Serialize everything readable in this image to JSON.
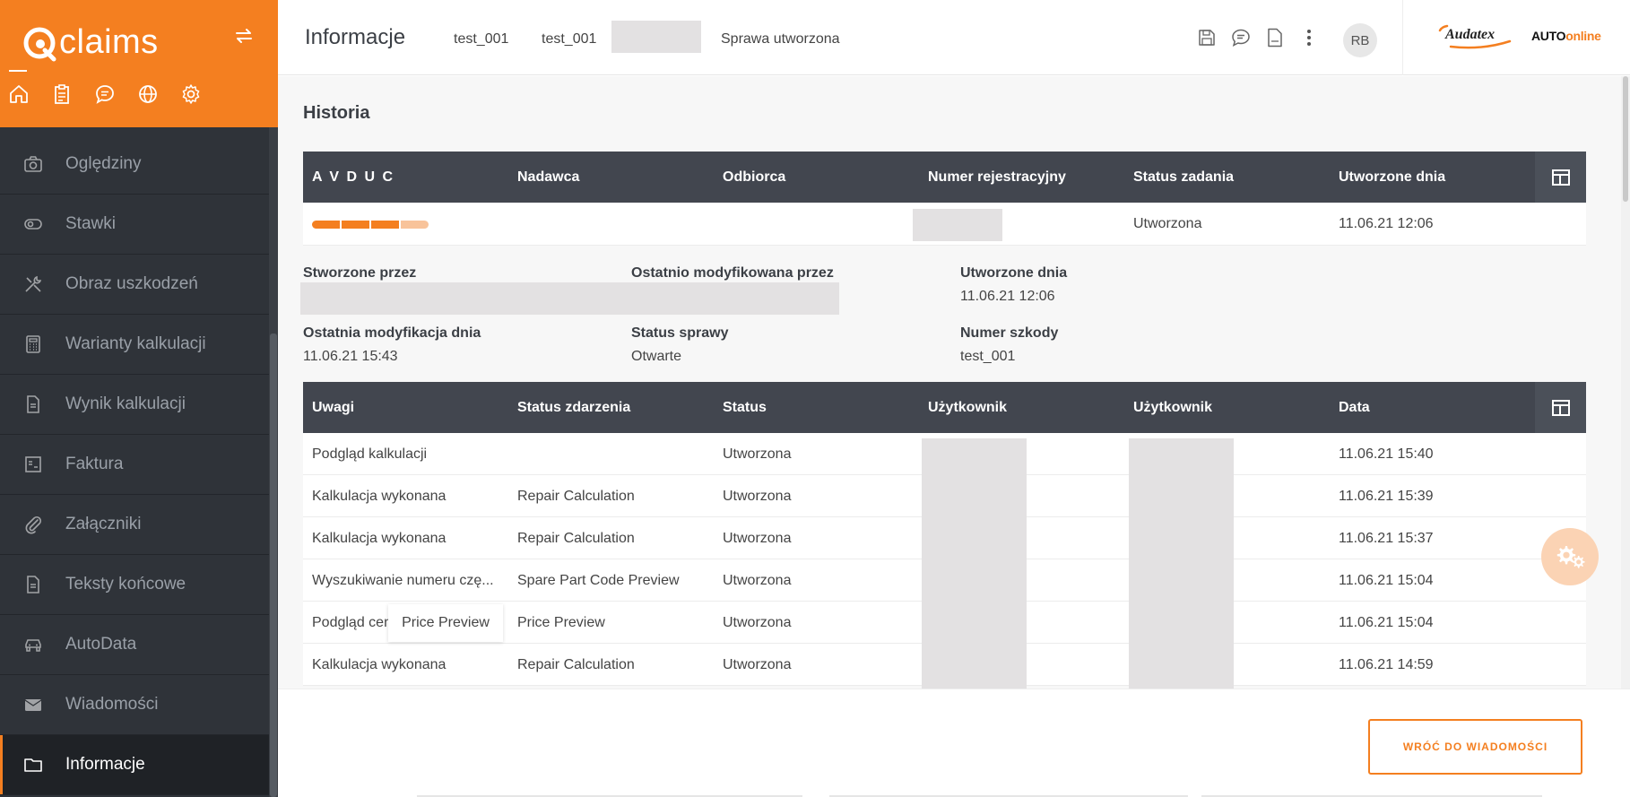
{
  "sidebar": {
    "brand": "claims",
    "items": [
      {
        "label": "Oględziny",
        "icon": "camera-icon"
      },
      {
        "label": "Stawki",
        "icon": "rates-icon"
      },
      {
        "label": "Obraz uszkodzeń",
        "icon": "tools-icon"
      },
      {
        "label": "Warianty kalkulacji",
        "icon": "calculator-icon"
      },
      {
        "label": "Wynik kalkulacji",
        "icon": "document-icon"
      },
      {
        "label": "Faktura",
        "icon": "invoice-icon"
      },
      {
        "label": "Załączniki",
        "icon": "paperclip-icon"
      },
      {
        "label": "Teksty końcowe",
        "icon": "document-icon"
      },
      {
        "label": "AutoData",
        "icon": "car-icon"
      },
      {
        "label": "Wiadomości",
        "icon": "mail-icon"
      },
      {
        "label": "Informacje",
        "icon": "folder-icon",
        "active": true
      }
    ]
  },
  "header": {
    "title": "Informacje",
    "case_id_1": "test_001",
    "case_id_2": "test_001",
    "status": "Sprawa utworzona",
    "avatar": "RB",
    "logo_audatex": "Audatex",
    "logo_auto": "AUTO",
    "logo_online": "online"
  },
  "history": {
    "title": "Historia",
    "columns": [
      "A V D U C",
      "Nadawca",
      "Odbiorca",
      "Numer rejestracyjny",
      "Status zadania",
      "Utworzone dnia"
    ],
    "progress_filled": 3,
    "progress_total": 4,
    "row": {
      "status": "Utworzona",
      "date": "11.06.21 12:06"
    }
  },
  "meta": {
    "created_by_label": "Stworzone przez",
    "modified_by_label": "Ostatnio modyfikowana przez",
    "created_on_label": "Utworzone dnia",
    "created_on_value": "11.06.21 12:06",
    "last_modified_label": "Ostatnia modyfikacja dnia",
    "last_modified_value": "11.06.21 15:43",
    "case_status_label": "Status sprawy",
    "case_status_value": "Otwarte",
    "damage_no_label": "Numer szkody",
    "damage_no_value": "test_001"
  },
  "events": {
    "columns": [
      "Uwagi",
      "Status zdarzenia",
      "Status",
      "Użytkownik",
      "Użytkownik",
      "Data"
    ],
    "rows": [
      {
        "note": "Podgląd kalkulacji",
        "event": "",
        "status": "Utworzona",
        "date": "11.06.21 15:40"
      },
      {
        "note": "Kalkulacja wykonana",
        "event": "Repair Calculation",
        "status": "Utworzona",
        "date": "11.06.21 15:39"
      },
      {
        "note": "Kalkulacja wykonana",
        "event": "Repair Calculation",
        "status": "Utworzona",
        "date": "11.06.21 15:37"
      },
      {
        "note": "Wyszukiwanie numeru czę...",
        "event": "Spare Part Code Preview",
        "status": "Utworzona",
        "date": "11.06.21 15:04"
      },
      {
        "note": "Podgląd cen",
        "event": "Price Preview",
        "status": "Utworzona",
        "date": "11.06.21 15:04"
      },
      {
        "note": "Kalkulacja wykonana",
        "event": "Repair Calculation",
        "status": "Utworzona",
        "date": "11.06.21 14:59"
      }
    ],
    "tooltip": "Price Preview"
  },
  "footer": {
    "back_button": "WRÓĆ DO WIADOMOŚCI"
  },
  "colors": {
    "accent": "#f47f20",
    "sidebar_bg": "#2f3339",
    "table_header": "#42464f"
  }
}
